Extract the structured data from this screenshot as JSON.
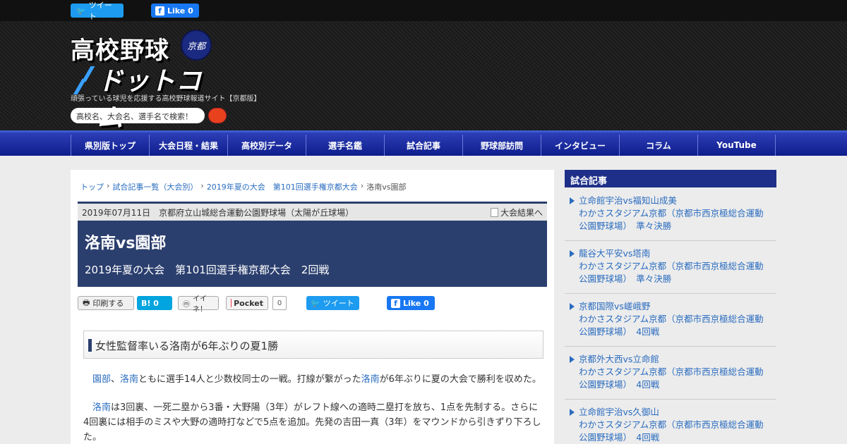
{
  "social_top": {
    "tweet": "ツイート",
    "fb_like": "Like 0"
  },
  "header": {
    "logo_line1": "高校野球",
    "logo_line2": "ドットコム",
    "logo_badge": "京都",
    "tagline": "頑張っている球児を応援する高校野球報道サイト【京都版】",
    "search_placeholder": "高校名、大会名、選手名で検索！"
  },
  "nav": [
    "県別版トップ",
    "大会日程・結果",
    "高校別データ",
    "選手名鑑",
    "試合記事",
    "野球部訪問",
    "インタビュー",
    "コラム",
    "YouTube"
  ],
  "breadcrumb": [
    "トップ",
    "試合記事一覧（大会別）",
    "2019年夏の大会　第101回選手権京都大会",
    "洛南vs園部"
  ],
  "article": {
    "date_venue": "2019年07月11日　京都府立山城総合運動公園野球場（太陽が丘球場）",
    "result_link": "大会結果へ",
    "title": "洛南vs園部",
    "subtitle": "2019年夏の大会　第101回選手権京都大会　2回戦",
    "headline": "女性監督率いる洛南が6年ぶりの夏1勝",
    "para1": {
      "team1": "園部",
      "sep": "、",
      "team2": "洛南",
      "text1": "ともに選手14人と少数校同士の一戦。打線が繋がった",
      "team3": "洛南",
      "text2": "が6年ぶりに夏の大会で勝利を収めた。"
    },
    "para2": {
      "team": "洛南",
      "text": "は3回裏、一死二塁から3番・大野陽（3年）がレフト線への適時二塁打を放ち、1点を先制する。さらに4回裏には相手のミスや大野の適時打などで5点を追加。先発の吉田一真（3年）をマウンドから引きずり下ろした。"
    }
  },
  "share": {
    "print": "印刷する",
    "hatena": "B! 0",
    "iine": "イイネ！",
    "pocket": "Pocket",
    "pocket_count": "0",
    "tweet": "ツイート",
    "fb_like": "Like 0"
  },
  "sidebar": {
    "title": "試合記事",
    "items": [
      {
        "title": "立命館宇治vs福知山成美",
        "venue": "わかさスタジアム京都（京都市西京極総合運動公園野球場）　準々決勝"
      },
      {
        "title": "龍谷大平安vs塔南",
        "venue": "わかさスタジアム京都（京都市西京極総合運動公園野球場）　準々決勝"
      },
      {
        "title": "京都国際vs嵯峨野",
        "venue": "わかさスタジアム京都（京都市西京極総合運動公園野球場）　4回戦"
      },
      {
        "title": "京都外大西vs立命館",
        "venue": "わかさスタジアム京都（京都市西京極総合運動公園野球場）　4回戦"
      },
      {
        "title": "立命館宇治vs久御山",
        "venue": "わかさスタジアム京都（京都市西京極総合運動公園野球場）　4回戦"
      }
    ]
  },
  "colors": {
    "nav_bg": "#0e1e8c",
    "title_bg": "#2b3f6e",
    "link": "#2a6cbf",
    "search_btn": "#e8411e"
  }
}
